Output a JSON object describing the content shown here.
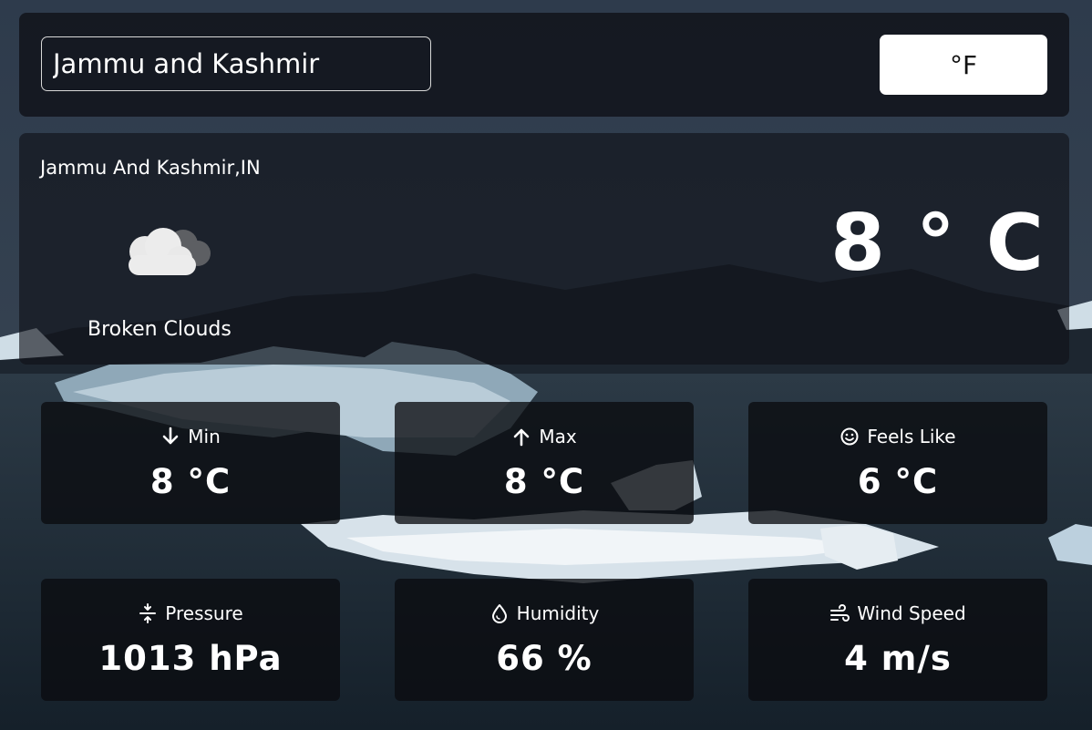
{
  "search": {
    "value": "Jammu and Kashmir"
  },
  "unit_toggle": {
    "label": "°F"
  },
  "current": {
    "location": "Jammu And Kashmir,IN",
    "condition": "Broken Clouds",
    "condition_icon": "broken-clouds-icon",
    "temperature": "8 ° C"
  },
  "stats": [
    {
      "label": "Min",
      "value": "8 °C",
      "icon": "arrow-down-icon"
    },
    {
      "label": "Max",
      "value": "8 °C",
      "icon": "arrow-up-icon"
    },
    {
      "label": "Feels Like",
      "value": "6 °C",
      "icon": "smiley-icon"
    },
    {
      "label": "Pressure",
      "value": "1013 hPa",
      "icon": "pressure-icon"
    },
    {
      "label": "Humidity",
      "value": "66 %",
      "icon": "droplet-icon"
    },
    {
      "label": "Wind Speed",
      "value": "4 m/s",
      "icon": "wind-icon"
    }
  ]
}
